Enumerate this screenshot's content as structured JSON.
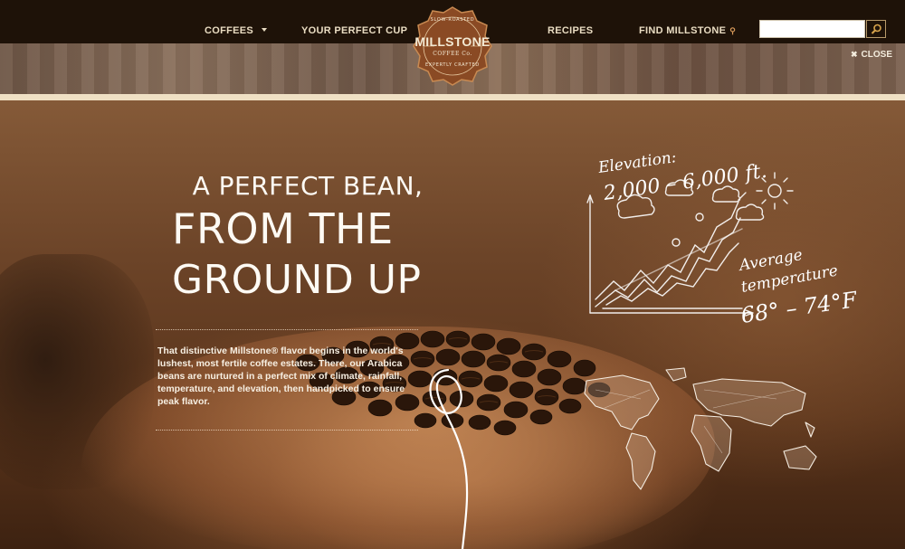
{
  "nav": {
    "items": [
      {
        "label": "COFFEES"
      },
      {
        "label": "YOUR PERFECT CUP"
      },
      {
        "label": "RECIPES"
      },
      {
        "label": "FIND MILLSTONE"
      }
    ],
    "search_value": ""
  },
  "logo": {
    "arc_top": "SLOW-ROASTED",
    "name": "MILLSTONE",
    "sub": "COFFEE Co.",
    "arc_bottom": "EXPERTLY CRAFTED"
  },
  "banner": {
    "close_label": "CLOSE"
  },
  "hero": {
    "title_line1": "A PERFECT BEAN,",
    "title_line2": "FROM THE",
    "title_line3": "GROUND UP",
    "body_intro": "That distinctive ",
    "body_brand": "Millstone®",
    "body_rest": " flavor begins in the world's lushest, most fertile coffee estates. There, our Arabica beans are nurtured in a perfect mix of climate, rainfall, temperature, and elevation, then handpicked to ensure peak flavor."
  },
  "sketch": {
    "elevation_label": "Elevation:",
    "elevation_value": "2,000 – 6,000 ft.",
    "temp_label_1": "Average",
    "temp_label_2": "temperature",
    "temp_value": "68° – 74°F"
  },
  "colors": {
    "nav_bg": "#1e1208",
    "nav_text": "#e9dcc2",
    "logo_badge": "#8a4a24",
    "band": "#efe0c4"
  }
}
